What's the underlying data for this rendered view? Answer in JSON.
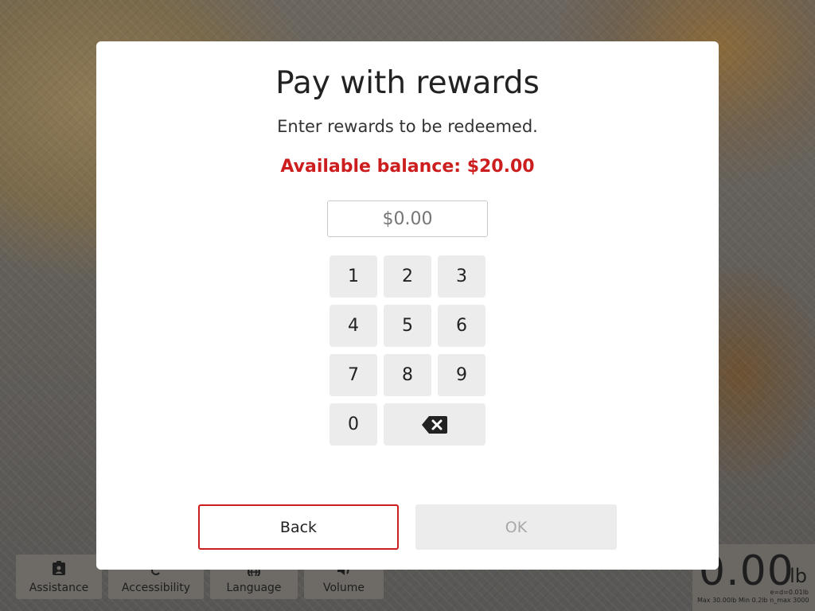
{
  "modal": {
    "title": "Pay with rewards",
    "subtitle": "Enter rewards to be redeemed.",
    "balance": "Available balance: $20.00",
    "amount_placeholder": "$0.00",
    "keys": [
      "1",
      "2",
      "3",
      "4",
      "5",
      "6",
      "7",
      "8",
      "9",
      "0"
    ],
    "back_label": "Back",
    "ok_label": "OK"
  },
  "toolbar": {
    "assistance": "Assistance",
    "accessibility": "Accessibility",
    "language": "Language",
    "volume": "Volume"
  },
  "scale": {
    "weight": "0.00",
    "unit": "lb",
    "info": "Max 30.00lb  Min 0.2lb  n_max 3000",
    "precision": "e=d=0.01lb"
  },
  "colors": {
    "accent": "#cc1e1e",
    "key_bg": "#ececec",
    "disabled_text": "#a8a8a8"
  }
}
